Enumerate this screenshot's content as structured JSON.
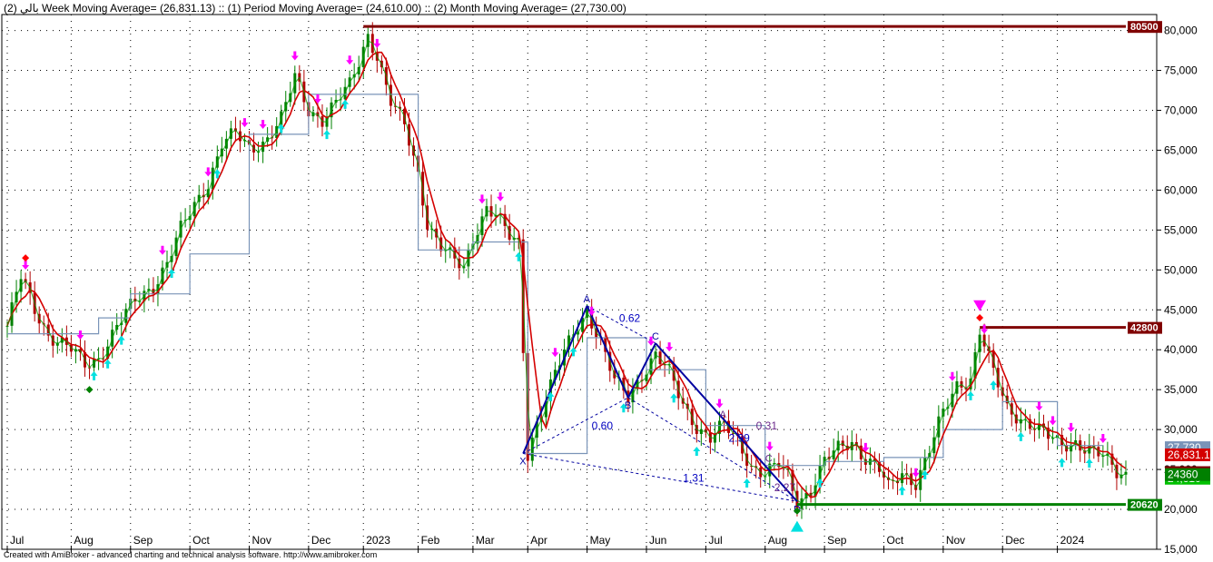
{
  "chart_data": {
    "type": "line",
    "title": "بالي (2) Week Moving Average= (26,831.13) :: (1) Period Moving Average= (24,610.00) :: (2) Month Moving Average= (27,730.00)",
    "footer": "Created with AmiBroker - advanced charting and technical analysis software. http://www.amibroker.com",
    "ylim": [
      15000,
      82000
    ],
    "y_ticks": [
      15000,
      20000,
      25000,
      30000,
      35000,
      40000,
      45000,
      50000,
      55000,
      60000,
      65000,
      70000,
      75000,
      80000
    ],
    "y_tick_labels": [
      "15,000",
      "20,000",
      "25,000",
      "30,000",
      "35,000",
      "40,000",
      "45,000",
      "50,000",
      "55,000",
      "60,000",
      "65,000",
      "70,000",
      "75,000",
      "80,000"
    ],
    "x_labels": [
      "Jul",
      "Aug",
      "Sep",
      "Oct",
      "Nov",
      "Dec",
      "2023",
      "Feb",
      "Mar",
      "Apr",
      "May",
      "Jun",
      "Jul",
      "Aug",
      "Sep",
      "Oct",
      "Nov",
      "Dec",
      "2024"
    ],
    "x_label_index": [
      0,
      14,
      27,
      40,
      53,
      66,
      78,
      90,
      102,
      114,
      127,
      140,
      153,
      166,
      179,
      192,
      205,
      218,
      230
    ],
    "n_bars": 246,
    "price_anchors": [
      [
        0,
        43000
      ],
      [
        3,
        49000
      ],
      [
        6,
        45000
      ],
      [
        9,
        42000
      ],
      [
        14,
        40000
      ],
      [
        17,
        38000
      ],
      [
        20,
        39000
      ],
      [
        24,
        43000
      ],
      [
        28,
        46000
      ],
      [
        32,
        48000
      ],
      [
        35,
        51000
      ],
      [
        38,
        55000
      ],
      [
        41,
        58000
      ],
      [
        44,
        61000
      ],
      [
        47,
        66000
      ],
      [
        50,
        67000
      ],
      [
        53,
        65000
      ],
      [
        56,
        66000
      ],
      [
        60,
        69000
      ],
      [
        63,
        74000
      ],
      [
        66,
        70000
      ],
      [
        69,
        69000
      ],
      [
        72,
        71000
      ],
      [
        75,
        73000
      ],
      [
        77,
        76000
      ],
      [
        79,
        79500
      ],
      [
        81,
        77000
      ],
      [
        84,
        71000
      ],
      [
        87,
        68000
      ],
      [
        90,
        62000
      ],
      [
        92,
        56000
      ],
      [
        95,
        53000
      ],
      [
        98,
        51000
      ],
      [
        100,
        50000
      ],
      [
        102,
        54000
      ],
      [
        105,
        58000
      ],
      [
        107,
        57000
      ],
      [
        110,
        54000
      ],
      [
        112,
        53000
      ],
      [
        114,
        27000
      ],
      [
        116,
        31000
      ],
      [
        120,
        37000
      ],
      [
        124,
        42000
      ],
      [
        127,
        45000
      ],
      [
        130,
        41000
      ],
      [
        133,
        36000
      ],
      [
        136,
        34000
      ],
      [
        139,
        37000
      ],
      [
        142,
        39500
      ],
      [
        145,
        37000
      ],
      [
        148,
        33000
      ],
      [
        151,
        30500
      ],
      [
        154,
        29000
      ],
      [
        157,
        30500
      ],
      [
        160,
        28500
      ],
      [
        163,
        25500
      ],
      [
        166,
        24500
      ],
      [
        169,
        25500
      ],
      [
        171,
        24000
      ],
      [
        173,
        21000
      ],
      [
        176,
        22500
      ],
      [
        179,
        26000
      ],
      [
        182,
        27500
      ],
      [
        185,
        28500
      ],
      [
        188,
        26500
      ],
      [
        191,
        25000
      ],
      [
        193,
        22500
      ],
      [
        196,
        24500
      ],
      [
        199,
        23500
      ],
      [
        202,
        27500
      ],
      [
        205,
        32000
      ],
      [
        208,
        35500
      ],
      [
        211,
        36500
      ],
      [
        213,
        42500
      ],
      [
        216,
        37000
      ],
      [
        219,
        32500
      ],
      [
        222,
        31500
      ],
      [
        225,
        30500
      ],
      [
        228,
        29000
      ],
      [
        231,
        28000
      ],
      [
        234,
        28500
      ],
      [
        237,
        27500
      ],
      [
        240,
        26500
      ],
      [
        243,
        24600
      ]
    ],
    "series": [
      {
        "name": "Week Moving Average",
        "last_value": 26831.13,
        "color": "#d40000"
      },
      {
        "name": "Period Moving Average",
        "last_value": 24610.0,
        "color": "#00a000"
      },
      {
        "name": "Month Moving Average",
        "last_value": 27730.0,
        "color": "#7a94b8"
      }
    ],
    "month_ma_steps": [
      [
        0,
        42000
      ],
      [
        20,
        42000
      ],
      [
        20,
        44000
      ],
      [
        27,
        44000
      ],
      [
        27,
        47000
      ],
      [
        40,
        47000
      ],
      [
        40,
        52000
      ],
      [
        53,
        52000
      ],
      [
        53,
        67000
      ],
      [
        66,
        67000
      ],
      [
        66,
        72000
      ],
      [
        78,
        72000
      ],
      [
        78,
        72000
      ],
      [
        90,
        72000
      ],
      [
        90,
        52500
      ],
      [
        102,
        52500
      ],
      [
        102,
        53500
      ],
      [
        114,
        53500
      ],
      [
        114,
        27000
      ],
      [
        127,
        27000
      ],
      [
        127,
        41500
      ],
      [
        140,
        41500
      ],
      [
        140,
        37500
      ],
      [
        153,
        37500
      ],
      [
        153,
        30500
      ],
      [
        166,
        30500
      ],
      [
        166,
        25500
      ],
      [
        179,
        25500
      ],
      [
        179,
        26000
      ],
      [
        192,
        26000
      ],
      [
        192,
        26500
      ],
      [
        205,
        26500
      ],
      [
        205,
        30000
      ],
      [
        218,
        30000
      ],
      [
        218,
        33500
      ],
      [
        230,
        33500
      ],
      [
        230,
        28000
      ],
      [
        240,
        28000
      ]
    ],
    "horizontal_levels": [
      {
        "label": "80500",
        "value": 80500,
        "from_index": 78,
        "color": "#800000"
      },
      {
        "label": "42800",
        "value": 42800,
        "from_index": 213,
        "color": "#800000"
      },
      {
        "label": "20620",
        "value": 20620,
        "from_index": 173,
        "color": "#008000"
      }
    ],
    "right_badges": [
      {
        "label": "27,730",
        "value": 27730,
        "bg": "#7a94b8",
        "fg": "#ffffff"
      },
      {
        "label": "26,831.1",
        "value": 26831,
        "bg": "#d40000",
        "fg": "#ffffff"
      },
      {
        "label": "24,610",
        "value": 24610,
        "bg": "#800000",
        "fg": "#ffffff"
      },
      {
        "label": "24,610",
        "value": 23900,
        "bg": "#00c000",
        "fg": "#ffffff"
      },
      {
        "label": "24360",
        "value": 24360,
        "bg": "#008000",
        "fg": "#ffffff"
      }
    ],
    "harmonic": {
      "points": [
        {
          "label": "X",
          "index": 113,
          "value": 27000
        },
        {
          "label": "A",
          "index": 127,
          "value": 45500
        },
        {
          "label": "B",
          "index": 136,
          "value": 34000
        },
        {
          "label": "C",
          "index": 142,
          "value": 40800
        },
        {
          "label": "D",
          "index": 173,
          "value": 21000
        }
      ],
      "ratios": [
        {
          "text": "0.62",
          "index": 134,
          "value": 43500
        },
        {
          "text": "0.60",
          "index": 128,
          "value": 30000
        },
        {
          "text": "1.31",
          "index": 148,
          "value": 23500
        },
        {
          "text": "2.99",
          "index": 158,
          "value": 28500
        }
      ]
    },
    "mini_pattern": {
      "points": [
        {
          "label": "A",
          "index": 156,
          "value": 31500
        },
        {
          "label": "C",
          "index": 166,
          "value": 26000
        }
      ],
      "ratios": [
        {
          "text": "0.31",
          "index": 164,
          "value": 30000
        },
        {
          "text": "2.27",
          "index": 168,
          "value": 22300
        }
      ]
    },
    "buy_arrows": [
      19,
      22,
      25,
      36,
      46,
      60,
      70,
      74,
      112,
      119,
      124,
      135,
      146,
      151,
      162,
      178,
      196,
      201,
      211,
      216,
      222,
      231,
      237
    ],
    "sell_arrows": [
      4,
      16,
      34,
      44,
      52,
      56,
      63,
      68,
      75,
      81,
      104,
      108,
      120,
      128,
      141,
      145,
      156,
      167,
      188,
      199,
      207,
      214,
      226,
      229,
      233,
      240
    ],
    "big_sell_index": 213,
    "big_buy_index": 173,
    "diamonds": [
      {
        "index": 4,
        "value": 51500,
        "color": "#ff0000"
      },
      {
        "index": 18,
        "value": 35000,
        "color": "#008000"
      },
      {
        "index": 213,
        "value": 44000,
        "color": "#ff0000"
      },
      {
        "index": 173,
        "value": 19800,
        "color": "#008000"
      }
    ],
    "grid": true,
    "legend": "title-bar"
  }
}
